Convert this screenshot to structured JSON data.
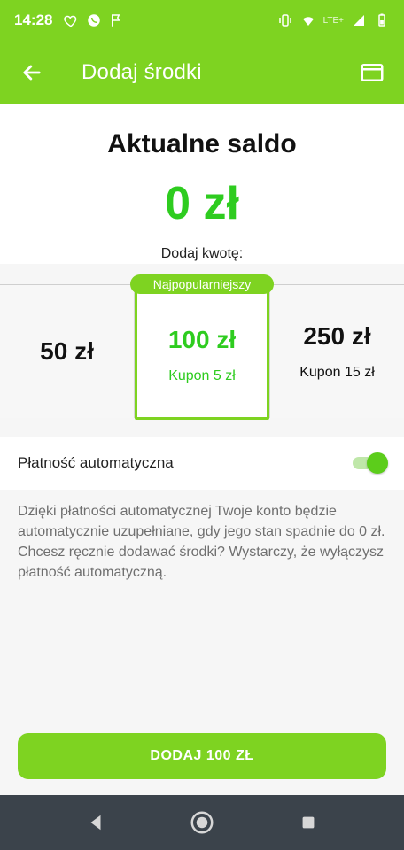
{
  "status": {
    "time": "14:28",
    "left_icons": [
      "heart-icon",
      "whatsapp-icon",
      "flag-icon"
    ],
    "right_icons": [
      "vibrate-icon",
      "wifi-icon",
      "lte-signal-icon",
      "battery-icon"
    ],
    "network_label": "LTE+"
  },
  "appbar": {
    "title": "Dodaj środki",
    "back_icon": "arrow-left-icon",
    "card_icon": "credit-card-icon"
  },
  "balance": {
    "title": "Aktualne saldo",
    "value": "0 zł"
  },
  "add_amount": {
    "label": "Dodaj kwotę:"
  },
  "tiles": [
    {
      "amount": "50 zł",
      "coupon": ""
    },
    {
      "amount": "100 zł",
      "coupon": "Kupon 5 zł"
    },
    {
      "amount": "250 zł",
      "coupon": "Kupon 15 zł"
    }
  ],
  "popular_badge": "Najpopularniejszy",
  "auto_payment": {
    "label": "Płatność automatyczna",
    "enabled": true
  },
  "info_text": "Dzięki płatności automatycznej Twoje konto będzie automatycznie uzupełniane, gdy jego stan spadnie do 0 zł. Chcesz ręcznie dodawać środki? Wystarczy, że wyłączysz płatność automatyczną.",
  "cta": {
    "label": "DODAJ 100 ZŁ"
  },
  "nav": {
    "back_icon": "nav-back-icon",
    "home_icon": "nav-home-icon",
    "recents_icon": "nav-recents-icon"
  },
  "colors": {
    "brand_green": "#7ed321",
    "accent_green": "#2ecc1f",
    "nav_dark": "#3b434b"
  }
}
